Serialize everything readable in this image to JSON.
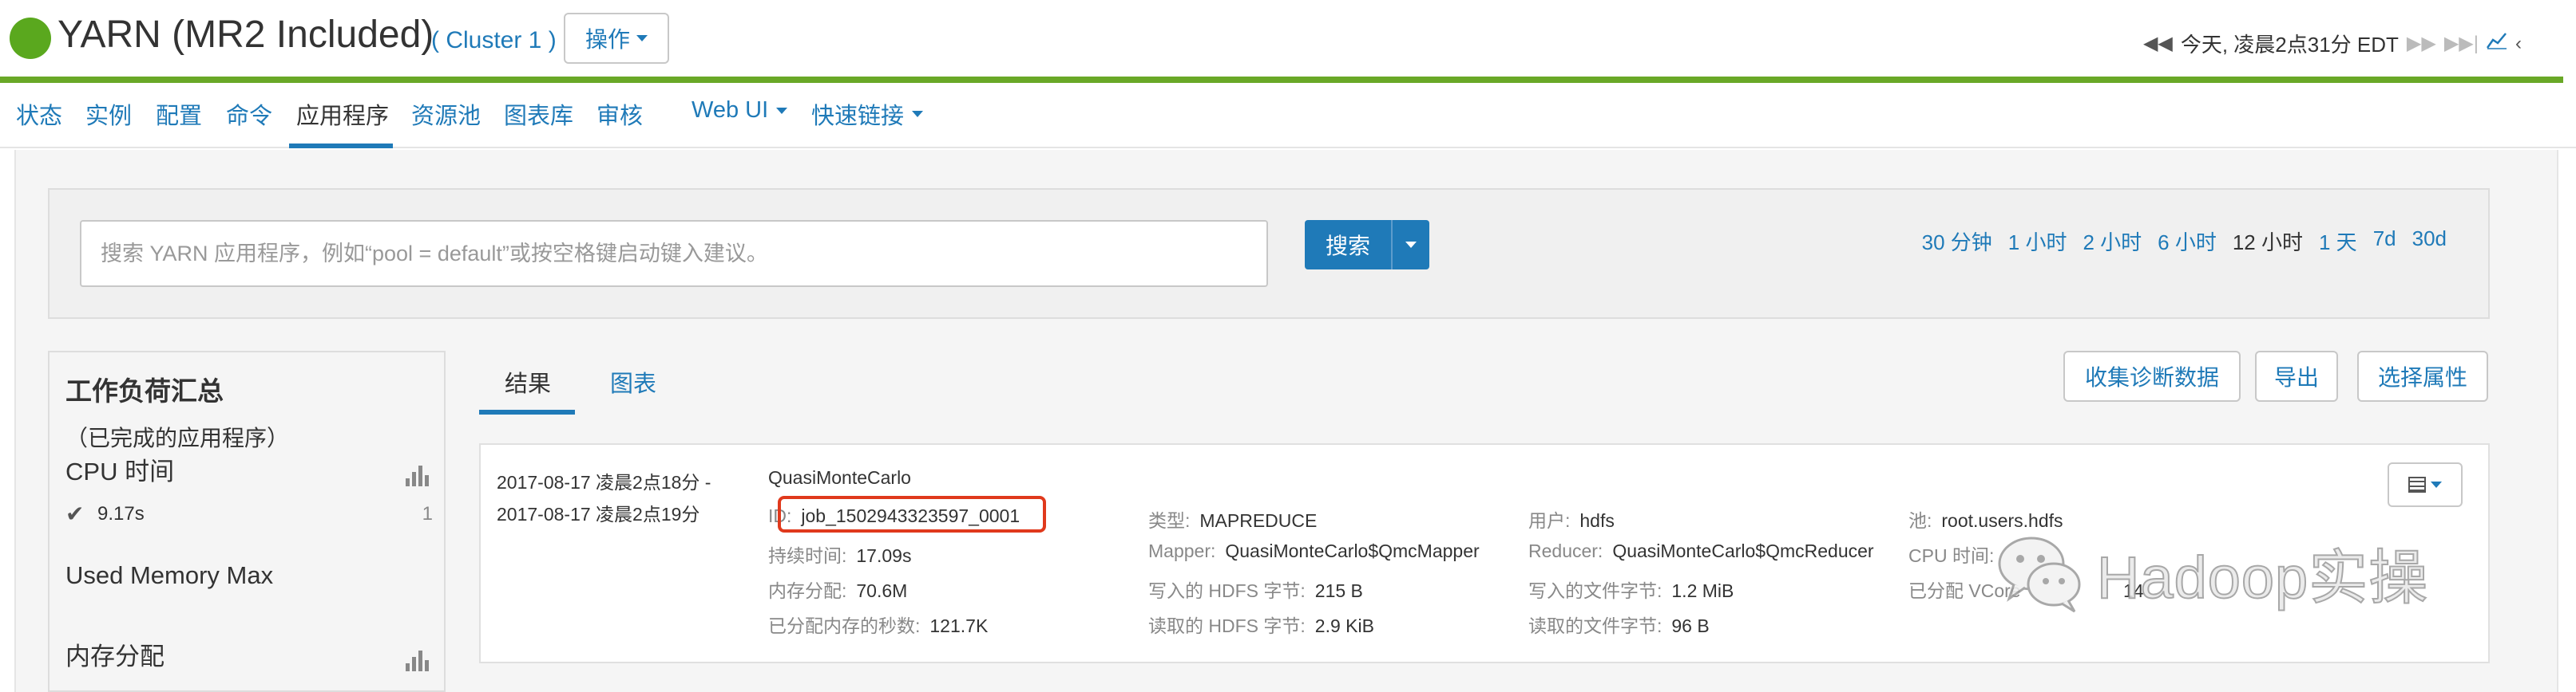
{
  "header": {
    "title": "YARN (MR2 Included)",
    "cluster": "( Cluster 1 )",
    "actions_label": "操作",
    "time_label": "今天, 凌晨2点31分 EDT",
    "status_color": "#5aa81e"
  },
  "nav": {
    "items": [
      {
        "label": "状态"
      },
      {
        "label": "实例"
      },
      {
        "label": "配置"
      },
      {
        "label": "命令"
      },
      {
        "label": "应用程序"
      },
      {
        "label": "资源池"
      },
      {
        "label": "图表库"
      },
      {
        "label": "审核"
      },
      {
        "label": "Web UI"
      },
      {
        "label": "快速链接"
      }
    ],
    "active": "应用程序"
  },
  "search": {
    "placeholder": "搜索 YARN 应用程序，例如“pool = default”或按空格键启动键入建议。",
    "button_label": "搜索"
  },
  "time_ranges": [
    "30 分钟",
    "1 小时",
    "2 小时",
    "6 小时",
    "12 小时",
    "1 天",
    "7d",
    "30d"
  ],
  "time_range_active": "12 小时",
  "workload": {
    "title": "工作负荷汇总",
    "subtitle": "（已完成的应用程序）",
    "cpu_label": "CPU 时间",
    "cpu_value": "9.17s",
    "cpu_count": "1",
    "memory_max_label": "Used Memory Max",
    "memory_alloc_label": "内存分配"
  },
  "tabs": {
    "results": "结果",
    "charts": "图表"
  },
  "buttons": {
    "collect": "收集诊断数据",
    "export": "导出",
    "select_attrs": "选择属性"
  },
  "result": {
    "start": "2017-08-17 凌晨2点18分  -",
    "end": "2017-08-17 凌晨2点19分",
    "name": "QuasiMonteCarlo",
    "id_label": "ID:",
    "id_value": "job_1502943323597_0001",
    "duration_label": "持续时间:",
    "duration_value": "17.09s",
    "mem_label": "内存分配:",
    "mem_value": "70.6M",
    "memsec_label": "已分配内存的秒数:",
    "memsec_value": "121.7K",
    "type_label": "类型:",
    "type_value": "MAPREDUCE",
    "mapper_label": "Mapper:",
    "mapper_value": "QuasiMonteCarlo$QmcMapper",
    "hdfs_write_label": "写入的 HDFS 字节:",
    "hdfs_write_value": "215 B",
    "hdfs_read_label": "读取的 HDFS 字节:",
    "hdfs_read_value": "2.9 KiB",
    "user_label": "用户:",
    "user_value": "hdfs",
    "reducer_label": "Reducer:",
    "reducer_value": "QuasiMonteCarlo$QmcReducer",
    "file_write_label": "写入的文件字节:",
    "file_write_value": "1.2 MiB",
    "file_read_label": "读取的文件字节:",
    "file_read_value": "96 B",
    "pool_label": "池:",
    "pool_value": "root.users.hdfs",
    "cpu_label": "CPU 时间:",
    "vcore_label": "已分配 VCore",
    "vcore_value": "14"
  },
  "watermark": "Hadoop实操",
  "colors": {
    "accent": "#1f7ab8",
    "green_bar": "#69a827",
    "highlight": "#e0391c"
  }
}
